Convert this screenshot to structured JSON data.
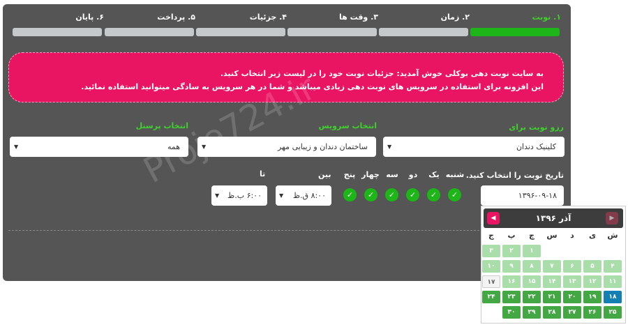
{
  "steps": [
    {
      "label": "۱. نوبت",
      "active": true
    },
    {
      "label": "۲. زمان",
      "active": false
    },
    {
      "label": "۳. وقت ها",
      "active": false
    },
    {
      "label": "۴. جزئیات",
      "active": false
    },
    {
      "label": "۵. پرداخت",
      "active": false
    },
    {
      "label": "۶. پایان",
      "active": false
    }
  ],
  "welcome": {
    "line1": "به سایت نوبت دهی بوکلی خوش آمدید: جزئیات نوبت خود را در لیست زیر انتخاب کنید.",
    "line2": "این افزونه برای استفاده در سرویس های نوبت دهی زیادی میباشد و شما در هر سرویس به سادگی میتوانید استفاده نمائید."
  },
  "watermark": "Proje724.ir",
  "form": {
    "category_label": "رزو نوبت برای",
    "category_value": "کلینیک دندان",
    "service_label": "انتخاب سرویس",
    "service_value": "ساختمان دندان و زیبایی مهر",
    "staff_label": "انتخاب پرسنل",
    "staff_value": "همه",
    "date_label": "تاریخ نوبت را انتخاب کنید.",
    "date_value": "۱۳۹۶-۰۹-۱۸",
    "days": [
      "شنبه",
      "یک",
      "دو",
      "سه",
      "چهار",
      "پنج"
    ],
    "between_label": "بین",
    "to_label": "تا",
    "time_from": "۸:۰۰ ق.ظ",
    "time_to": "۶:۰۰ ب.ظ",
    "check_symbol": "✓",
    "caret": "▼"
  },
  "calendar": {
    "title": "آذر ۱۳۹۶",
    "weekdays": [
      "ش",
      "ی",
      "د",
      "س",
      "چ",
      "پ",
      "ج"
    ],
    "rows": [
      [
        {
          "t": "",
          "k": ""
        },
        {
          "t": "",
          "k": ""
        },
        {
          "t": "",
          "k": ""
        },
        {
          "t": "",
          "k": ""
        },
        {
          "t": "۱",
          "k": "light"
        },
        {
          "t": "۲",
          "k": "light"
        },
        {
          "t": "۳",
          "k": "light"
        }
      ],
      [
        {
          "t": "۴",
          "k": "light"
        },
        {
          "t": "۵",
          "k": "light"
        },
        {
          "t": "۶",
          "k": "light"
        },
        {
          "t": "۷",
          "k": "light"
        },
        {
          "t": "۸",
          "k": "light"
        },
        {
          "t": "۹",
          "k": "light"
        },
        {
          "t": "۱۰",
          "k": "light"
        }
      ],
      [
        {
          "t": "۱۱",
          "k": "light"
        },
        {
          "t": "۱۲",
          "k": "light"
        },
        {
          "t": "۱۳",
          "k": "light"
        },
        {
          "t": "۱۴",
          "k": "light"
        },
        {
          "t": "۱۵",
          "k": "light"
        },
        {
          "t": "۱۶",
          "k": "light"
        },
        {
          "t": "۱۷",
          "k": "today"
        }
      ],
      [
        {
          "t": "۱۸",
          "k": "sel"
        },
        {
          "t": "۱۹",
          "k": "dark"
        },
        {
          "t": "۲۰",
          "k": "dark"
        },
        {
          "t": "۲۱",
          "k": "dark"
        },
        {
          "t": "۲۲",
          "k": "dark"
        },
        {
          "t": "۲۳",
          "k": "dark"
        },
        {
          "t": "۲۴",
          "k": "dark"
        }
      ],
      [
        {
          "t": "۲۵",
          "k": "dark"
        },
        {
          "t": "۲۶",
          "k": "dark"
        },
        {
          "t": "۲۷",
          "k": "dark"
        },
        {
          "t": "۲۸",
          "k": "dark"
        },
        {
          "t": "۲۹",
          "k": "dark"
        },
        {
          "t": "۳۰",
          "k": "dark"
        },
        {
          "t": "",
          "k": ""
        }
      ]
    ],
    "prev_symbol": "◀",
    "next_symbol": "▶"
  },
  "colors": {
    "accent": "#ea1562",
    "green": "#1db518",
    "panel": "#555555",
    "selected": "#137fb3"
  }
}
